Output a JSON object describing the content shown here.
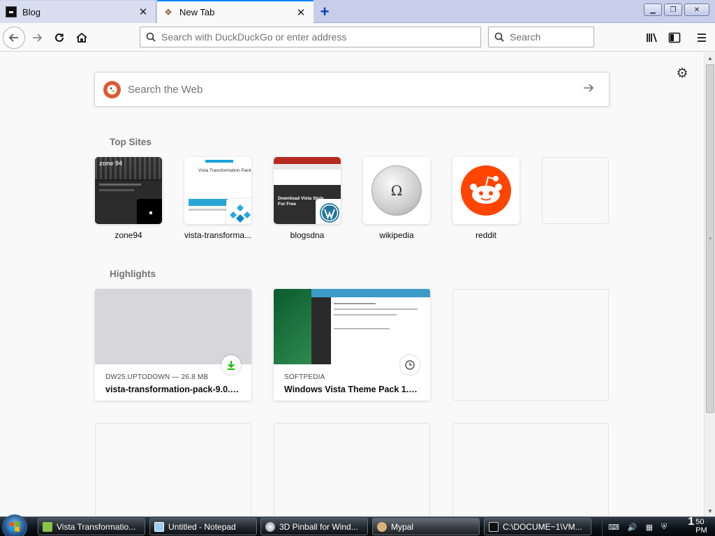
{
  "browser": {
    "tabs": [
      {
        "title": "Blog",
        "active": false
      },
      {
        "title": "New Tab",
        "active": true
      }
    ],
    "urlbar_placeholder": "Search with DuckDuckGo or enter address",
    "searchbar_placeholder": "Search",
    "accent_color": "#0a84ff"
  },
  "newtab": {
    "web_search_placeholder": "Search the Web",
    "top_sites_title": "Top Sites",
    "top_sites": [
      {
        "label": "zone94"
      },
      {
        "label": "vista-transforma..."
      },
      {
        "label": "blogsdna"
      },
      {
        "label": "wikipedia"
      },
      {
        "label": "reddit"
      }
    ],
    "highlights_title": "Highlights",
    "highlights": [
      {
        "source": "DW25.UPTODOWN — 26.8 MB",
        "title": "vista-transformation-pack-9.0.1...",
        "icon": "download-icon"
      },
      {
        "source": "SOFTPEDIA",
        "title": "Windows Vista Theme Pack 1.0 -...",
        "icon": "clock-icon"
      }
    ],
    "thumb_text": {
      "zone94": "zone 94",
      "vista": "Vista Transformation Pack",
      "blogsdna": "Download Vista Style For Free",
      "wikipedia_glyph": "Ω"
    }
  },
  "taskbar": {
    "items": [
      {
        "label": "Vista Transformatio...",
        "icon_color": "#8bc34a"
      },
      {
        "label": "Untitled - Notepad",
        "icon_color": "#9ecbf0"
      },
      {
        "label": "3D Pinball for Wind...",
        "icon_color": "#c0c4cc"
      },
      {
        "label": "Mypal",
        "icon_color": "#d9b27a"
      },
      {
        "label": "C:\\DOCUME~1\\VM...",
        "icon_color": "#333"
      }
    ],
    "clock": {
      "time": "1",
      "minutes": "50",
      "ampm": "PM"
    }
  }
}
